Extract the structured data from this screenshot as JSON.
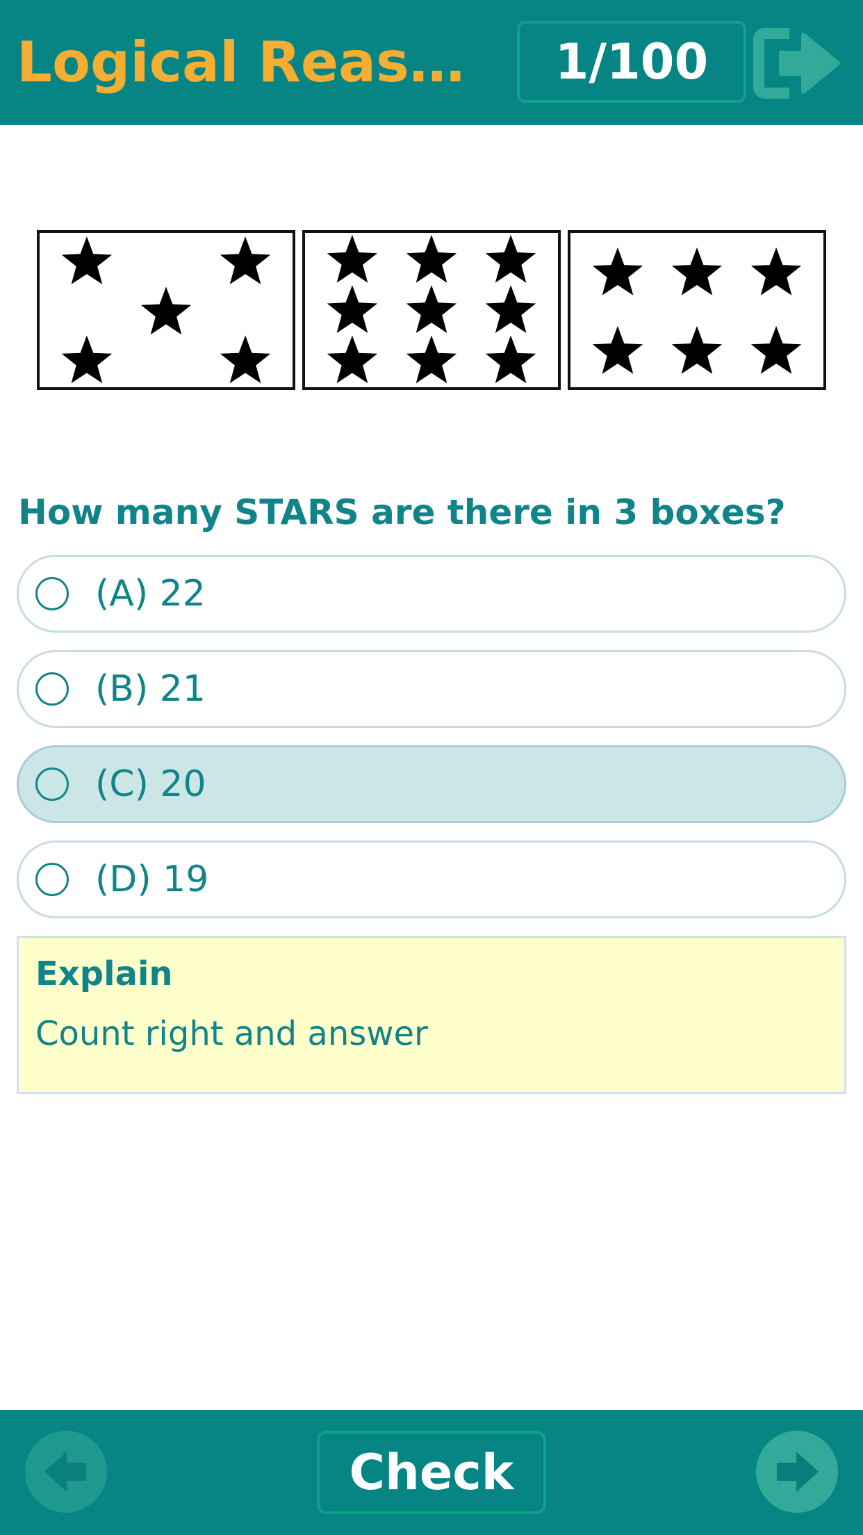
{
  "header": {
    "title": "Logical Reasoning",
    "counter": "1/100",
    "exit_icon": "exit-arrow-icon"
  },
  "puzzle": {
    "boxes": [
      {
        "star_count": 5,
        "layout": "dice-five"
      },
      {
        "star_count": 9,
        "layout": "grid-3x3"
      },
      {
        "star_count": 6,
        "layout": "grid-3x2"
      }
    ]
  },
  "question": {
    "text": "How many STARS are there in 3 boxes?",
    "options": [
      {
        "label": "(A) 22",
        "selected": false
      },
      {
        "label": "(B) 21",
        "selected": false
      },
      {
        "label": "(C) 20",
        "selected": true
      },
      {
        "label": "(D) 19",
        "selected": false
      }
    ]
  },
  "explain": {
    "title": "Explain",
    "text": "Count right and answer"
  },
  "footer": {
    "check_label": "Check",
    "prev_icon": "arrow-left-icon",
    "next_icon": "arrow-right-icon"
  },
  "colors": {
    "header_bg": "#078585",
    "title": "#f5ae32",
    "text": "#11848a",
    "selected_bg": "#cce6e6",
    "explain_bg": "#ffffcc"
  }
}
